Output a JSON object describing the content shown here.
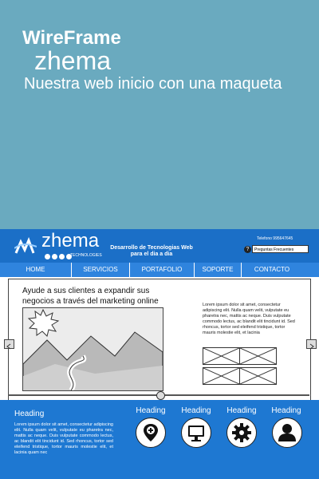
{
  "banner": {
    "line1": "WireFrame",
    "line2": "zhema",
    "line3": "Nuestra web inicio con una maqueta"
  },
  "mock": {
    "logo": "zhema",
    "logo_sub": "TECHNOLOGIES",
    "tagline": "Desarrollo de Tecnologias Web para el dia a dia",
    "phone": "Telefono 995647645",
    "faq_icon": "?",
    "faq": "Preguntas Frecuentes",
    "nav": [
      "HOME",
      "SERVICIOS",
      "PORTAFOLIO",
      "SOPORTE",
      "CONTACTO"
    ],
    "headline": "Ayude a sus clientes a expandir sus negocios a través del marketing online",
    "lorem_side": "Lorem ipsum dolor sit amet, consectetur adipiscing elit. Nulla quam velit, vulputate eu pharetra nec, mattis ac neque. Duis vulputate commodo lectus, ac blandit elit tincidunt id. Sed rhoncus, tortor sed eleifend tristique, tortor mauris molestie elit, et lacinia",
    "footer": {
      "heading": "Heading",
      "lorem": "Lorem ipsum dolor sit amet, consectetur adipiscing elit. Nulla quam velit, vulputate eu pharetra nec, mattis ac neque. Duis vulputate commodo lectus, ac blandit elit tincidunt id. Sed rhoncus, tortor sed eleifend tristique, tortor mauris molestie elit, et lacinia quam nec",
      "features": [
        "Heading",
        "Heading",
        "Heading",
        "Heading"
      ]
    }
  },
  "colors": {
    "banner_bg": "#6aaabf",
    "brand_blue": "#1b6fc7",
    "nav_blue": "#2f84de",
    "footer_blue": "#1e78d2"
  },
  "icons": [
    "map-pin-icon",
    "monitor-icon",
    "gear-icon",
    "user-icon"
  ]
}
